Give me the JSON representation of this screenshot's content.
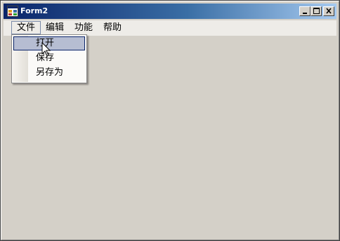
{
  "window": {
    "title": "Form2",
    "controls": {
      "minimize": "minimize-icon",
      "maximize": "maximize-icon",
      "close": "close-icon"
    },
    "title_gradient": [
      "#0a246a",
      "#a6caf0"
    ]
  },
  "menubar": {
    "items": [
      {
        "label": "文件",
        "open": true
      },
      {
        "label": "编辑"
      },
      {
        "label": "功能"
      },
      {
        "label": "帮助"
      }
    ]
  },
  "file_menu": {
    "items": [
      {
        "label": "打开",
        "highlighted": true
      },
      {
        "label": "保存"
      },
      {
        "label": "另存为"
      }
    ]
  },
  "colors": {
    "background": "#d4d0c8",
    "menu_highlight": "#b6bdd2",
    "menu_highlight_border": "#0a246a"
  },
  "icons": {
    "app": "form-app-icon",
    "pointer": "mouse-pointer-icon"
  }
}
